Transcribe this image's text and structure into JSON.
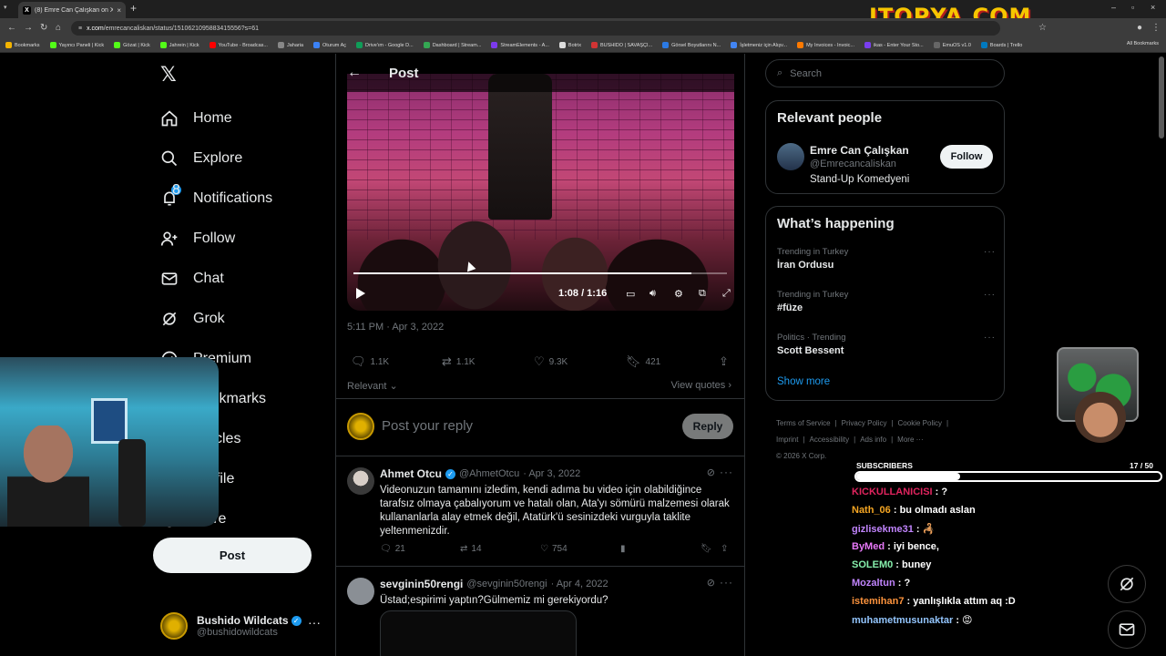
{
  "browser": {
    "tab_title": "(8) Emre Can Çalışkan on X",
    "url_domain": "x.com",
    "url_path": "/emrecancaliskan/status/1510621095883415556?s=61",
    "bookmarks": [
      {
        "label": "Bookmarks",
        "color": "#f4b400"
      },
      {
        "label": "Yayıncı Paneli | Kick",
        "color": "#53fc18"
      },
      {
        "label": "Gözat | Kick",
        "color": "#53fc18"
      },
      {
        "label": "Jahrein | Kick",
        "color": "#53fc18"
      },
      {
        "label": "YouTube - Broadcas...",
        "color": "#ff0000"
      },
      {
        "label": "Jaharia",
        "color": "#888888"
      },
      {
        "label": "Oturum Aç",
        "color": "#3b82f6"
      },
      {
        "label": "Drive'ım - Google D...",
        "color": "#0f9d58"
      },
      {
        "label": "Dashboard | Stream...",
        "color": "#34a853"
      },
      {
        "label": "StreamElements - A...",
        "color": "#7c3aed"
      },
      {
        "label": "Botrix",
        "color": "#dddddd"
      },
      {
        "label": "BUSHIDO | SAVAŞÇI...",
        "color": "#d13434"
      },
      {
        "label": "Görsel Boyutlarını N...",
        "color": "#2b7ae4"
      },
      {
        "label": "İşletmeniz için Alışv...",
        "color": "#4285f4"
      },
      {
        "label": "My Invoices - Invoic...",
        "color": "#ff7a00"
      },
      {
        "label": "ikas - Enter Your Sto...",
        "color": "#7a3ef0"
      },
      {
        "label": "EmuOS v1.0",
        "color": "#666666"
      },
      {
        "label": "Boards | Trello",
        "color": "#0079bf"
      }
    ],
    "all_bookmarks": "All Bookmarks",
    "overlay_logo": "ITOPYA.COM"
  },
  "nav": {
    "items": [
      {
        "label": "Home"
      },
      {
        "label": "Explore"
      },
      {
        "label": "Notifications",
        "badge": "8"
      },
      {
        "label": "Follow"
      },
      {
        "label": "Chat"
      },
      {
        "label": "Grok"
      },
      {
        "label": "Premium"
      },
      {
        "label": "Bookmarks"
      },
      {
        "label": "Articles"
      },
      {
        "label": "Profile"
      },
      {
        "label": "More"
      }
    ],
    "post_button": "Post",
    "account": {
      "name": "Bushido Wildcats",
      "handle": "@bushidowildcats"
    }
  },
  "post": {
    "header_title": "Post",
    "video_time": "1:08 / 1:16",
    "video_progress": 0.904,
    "timestamp": "5:11 PM · Apr 3, 2022",
    "stats": {
      "replies": "1.1K",
      "reposts": "1.1K",
      "likes": "9.3K",
      "bookmarks": "421"
    },
    "sort_label": "Relevant",
    "view_quotes": "View quotes",
    "reply_placeholder": "Post your reply",
    "reply_button": "Reply"
  },
  "replies": [
    {
      "name": "Ahmet Otcu",
      "handle": "@AhmetOtcu",
      "date": "· Apr 3, 2022",
      "text": "Videonuzun tamamını izledim, kendi adıma bu video için olabildiğince tarafsız olmaya çabalıyorum ve hatalı olan, Ata'yı sömürü malzemesi olarak kullananlarla alay etmek değil,  Atatürk'ü sesinizdeki vurguyla taklite yeltenmenizdir.",
      "replies": "21",
      "reposts": "14",
      "likes": "754"
    },
    {
      "name": "sevginin50rengi",
      "handle": "@sevginin50rengi",
      "date": "· Apr 4, 2022",
      "text": "Üstad;espirimi yaptın?Gülmemiz mi gerekiyordu?"
    }
  ],
  "right": {
    "search_placeholder": "Search",
    "relevant_title": "Relevant people",
    "person": {
      "name": "Emre Can Çalışkan",
      "handle": "@Emrecancaliskan",
      "bio": "Stand-Up Komedyeni",
      "follow": "Follow"
    },
    "happening_title": "What’s happening",
    "trends": [
      {
        "context": "Trending in Turkey",
        "title": "İran Ordusu"
      },
      {
        "context": "Trending in Turkey",
        "title": "#füze"
      },
      {
        "context": "Politics · Trending",
        "title": "Scott Bessent"
      }
    ],
    "show_more": "Show more",
    "footer": [
      "Terms of Service",
      "|",
      "Privacy Policy",
      "|",
      "Cookie Policy",
      "|",
      "Imprint",
      "|",
      "Accessibility",
      "|",
      "Ads info",
      "|",
      "More ···",
      "© 2026 X Corp."
    ]
  },
  "stream": {
    "subs_label": "SUBSCRIBERS",
    "subs_count": "17  / 50",
    "subs_progress": 0.34,
    "chat": [
      {
        "user": "KICKULLANICISI",
        "msg": " : ?",
        "color": "#e0245e"
      },
      {
        "user": "Nath_06",
        "msg": " : bu olmadı aslan",
        "color": "#f5a623"
      },
      {
        "user": "gizlisekme31",
        "msg": " : 🦂",
        "color": "#c084fc"
      },
      {
        "user": "ByMed",
        "msg": " : iyi bence,",
        "color": "#e879f9"
      },
      {
        "user": "SOLEM0",
        "msg": " : buney",
        "color": "#86efac"
      },
      {
        "user": "Mozaltun",
        "msg": " : ?",
        "color": "#c084fc"
      },
      {
        "user": "istemihan7",
        "msg": " : yanlışlıkla attım aq :D",
        "color": "#fb923c"
      },
      {
        "user": "muhametmusunaktar",
        "msg": " : 😡",
        "color": "#93c5fd"
      }
    ]
  }
}
